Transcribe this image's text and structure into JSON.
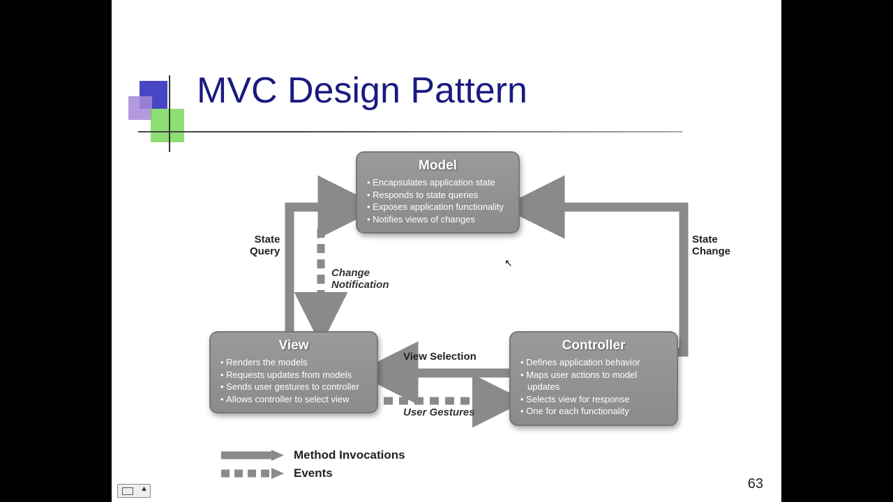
{
  "title": "MVC Design Pattern",
  "page_number": "63",
  "boxes": {
    "model": {
      "heading": "Model",
      "bullets": [
        "Encapsulates application state",
        "Responds to state queries",
        "Exposes application functionality",
        "Notifies views of changes"
      ]
    },
    "view": {
      "heading": "View",
      "bullets": [
        "Renders the models",
        "Requests updates from models",
        "Sends user gestures to controller",
        "Allows controller to select view"
      ]
    },
    "controller": {
      "heading": "Controller",
      "bullets": [
        "Defines application behavior",
        "Maps user actions to model updates",
        "Selects view for response",
        "One for each functionality"
      ]
    }
  },
  "edge_labels": {
    "state_query": "State\nQuery",
    "state_change": "State\nChange",
    "change_notification": "Change\nNotification",
    "view_selection": "View Selection",
    "user_gestures": "User Gestures"
  },
  "legend": {
    "solid": "Method Invocations",
    "dashed": "Events"
  }
}
